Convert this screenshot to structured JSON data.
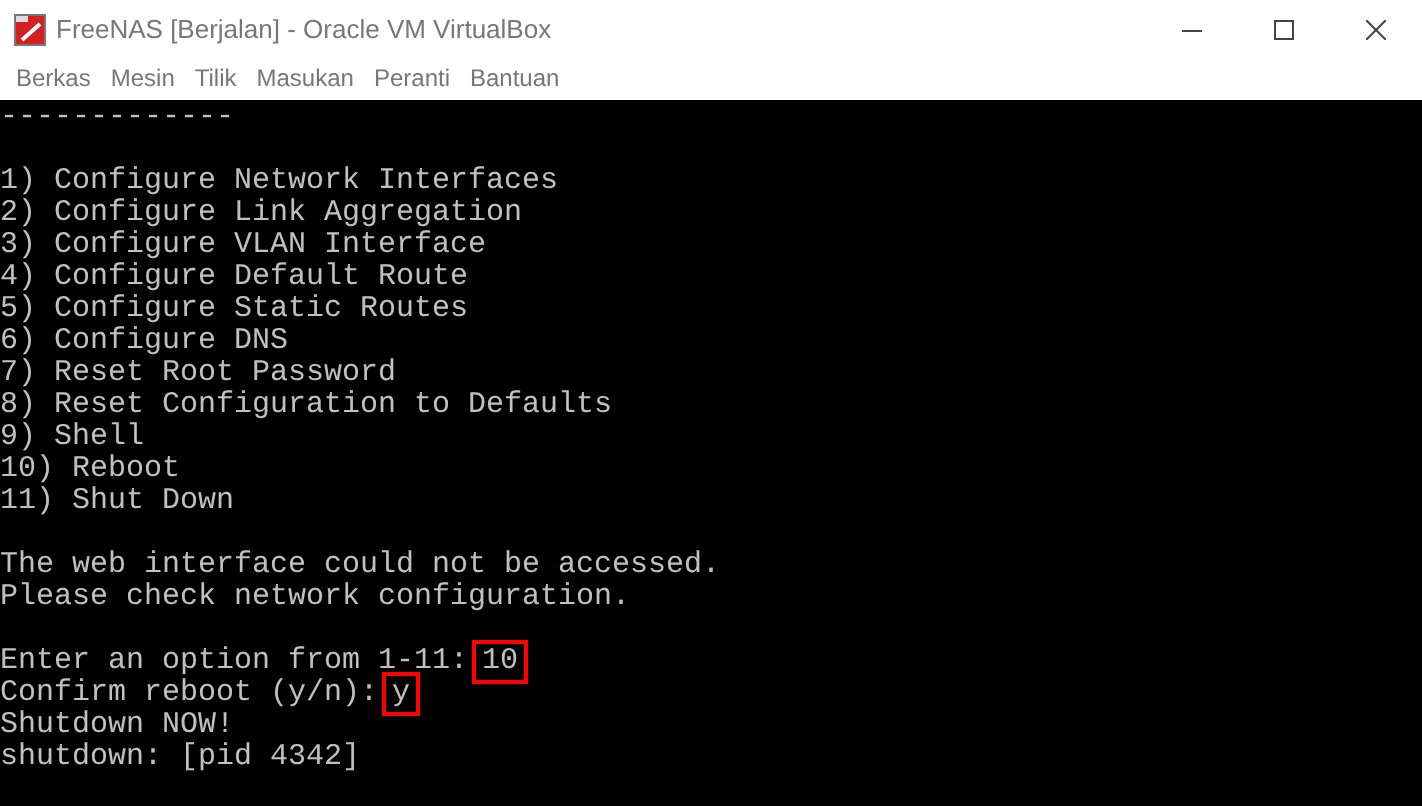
{
  "window": {
    "title": "FreeNAS [Berjalan] - Oracle VM VirtualBox"
  },
  "menu_bar": [
    "Berkas",
    "Mesin",
    "Tilik",
    "Masukan",
    "Peranti",
    "Bantuan"
  ],
  "console": {
    "blocks": [
      [
        {
          "text": "-------------"
        }
      ],
      [
        {
          "text": "1) Configure Network Interfaces"
        },
        {
          "text": "2) Configure Link Aggregation"
        },
        {
          "text": "3) Configure VLAN Interface"
        },
        {
          "text": "4) Configure Default Route"
        },
        {
          "text": "5) Configure Static Routes"
        },
        {
          "text": "6) Configure DNS"
        },
        {
          "text": "7) Reset Root Password"
        },
        {
          "text": "8) Reset Configuration to Defaults"
        },
        {
          "text": "9) Shell"
        },
        {
          "text": "10) Reboot"
        },
        {
          "text": "11) Shut Down"
        }
      ],
      [
        {
          "text": "The web interface could not be accessed."
        },
        {
          "text": "Please check network configuration."
        }
      ],
      [
        {
          "text": "Enter an option from 1-11:",
          "input": "10",
          "highlighted": true
        },
        {
          "text": "Confirm reboot (y/n):",
          "input": "y",
          "highlighted": true
        },
        {
          "text": "Shutdown NOW!"
        },
        {
          "text": "shutdown: [pid 4342]"
        }
      ]
    ]
  }
}
